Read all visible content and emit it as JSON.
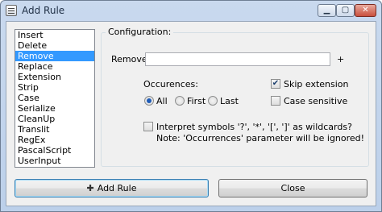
{
  "window": {
    "title": "Add Rule",
    "min_glyph": "▁",
    "max_glyph": "▢",
    "close_glyph": "✕"
  },
  "rules_list": {
    "items": [
      "Insert",
      "Delete",
      "Remove",
      "Replace",
      "Extension",
      "Strip",
      "Case",
      "Serialize",
      "CleanUp",
      "Translit",
      "RegEx",
      "PascalScript",
      "UserInput"
    ],
    "selected": "Remove"
  },
  "config": {
    "group_label": "Configuration:",
    "remove_label": "Remove:",
    "remove_value": "",
    "add_plus": "+",
    "occurrences_label": "Occurences:",
    "occ_all": "All",
    "occ_first": "First",
    "occ_last": "Last",
    "occ_selected": "All",
    "skip_extension": "Skip extension",
    "skip_extension_checked": true,
    "case_sensitive": "Case sensitive",
    "case_sensitive_checked": false,
    "interpret_symbols": "Interpret symbols '?', '*', '[', ']' as wildcards?",
    "interpret_checked": false,
    "note": "Note: 'Occurrences' parameter will be ignored!"
  },
  "buttons": {
    "add_rule": "Add Rule",
    "close": "Close"
  }
}
